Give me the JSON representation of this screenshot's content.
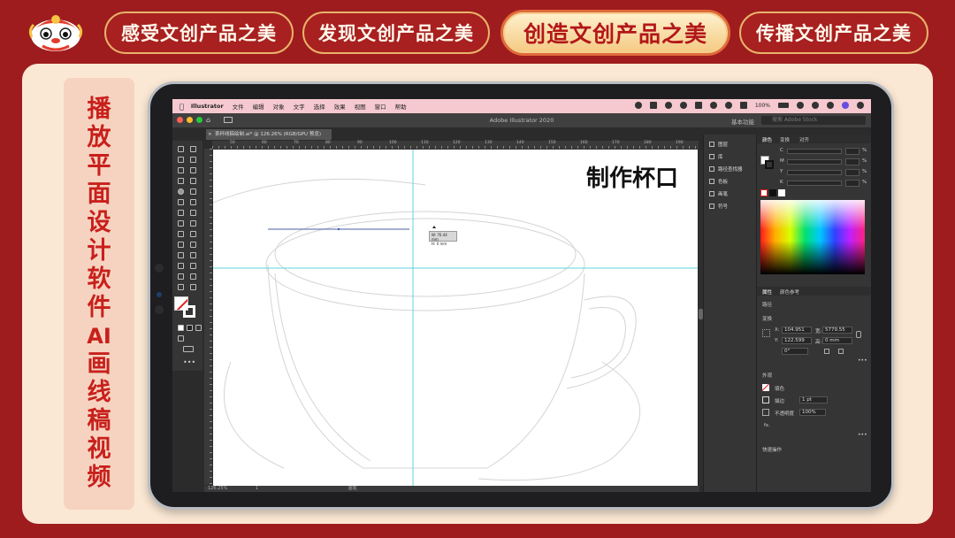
{
  "nav": {
    "tabs": [
      {
        "label": "感受文创产品之美",
        "active": false
      },
      {
        "label": "发现文创产品之美",
        "active": false
      },
      {
        "label": "创造文创产品之美",
        "active": true
      },
      {
        "label": "传播文创产品之美",
        "active": false
      }
    ]
  },
  "side_title": [
    "播",
    "放",
    "平",
    "面",
    "设",
    "计",
    "软",
    "件",
    "A",
    "I",
    "画",
    "线",
    "稿",
    "视",
    "频"
  ],
  "screen": {
    "menubar": {
      "app": "Illustrator",
      "items": [
        "文件",
        "编辑",
        "对象",
        "文字",
        "选择",
        "效果",
        "视图",
        "窗口",
        "帮助"
      ],
      "battery": "100%"
    },
    "titlebar": {
      "title": "Adobe Illustrator 2020",
      "workspace": "基本功能",
      "stock_placeholder": "搜索 Adobe Stock"
    },
    "doc_tab": "茶杯线稿绘制.ai* @ 126.26% (RGB/GPU 预览)",
    "ruler_ticks": [
      "50",
      "60",
      "70",
      "80",
      "90",
      "100",
      "110",
      "120",
      "130",
      "140",
      "150",
      "160",
      "170",
      "180",
      "190"
    ],
    "canvas_label": "制作杯口",
    "readout": {
      "w": "W: 76.44 mm",
      "h": "H: 0 mm"
    },
    "status": {
      "zoom": "126.25%",
      "page": "1",
      "mode": "画笔"
    },
    "mid_panel": [
      "图层",
      "库",
      "路径查找器",
      "色板",
      "画笔",
      "符号"
    ],
    "right_panel": {
      "tabs": [
        "颜色",
        "变换",
        "对齐"
      ],
      "channels": [
        "C",
        "M",
        "Y",
        "K"
      ],
      "percent": "%",
      "prop_tabs": [
        "属性",
        "颜色参考"
      ],
      "section_transform": "变换",
      "x_label": "X:",
      "x_value": "104.951",
      "y_label": "Y:",
      "y_value": "122.599",
      "w_label": "宽:",
      "w_value": "5779.55",
      "h_label": "高:",
      "h_value": "0 mm",
      "rotation": "0°",
      "section_appearance": "外观",
      "fill_label": "填色",
      "stroke_label": "描边",
      "stroke_value": "1 pt",
      "opacity_label": "不透明度",
      "opacity_value": "100%",
      "fx": "fx.",
      "quick_actions": "快速操作",
      "section_top": "路径"
    }
  },
  "colors": {
    "background": "#9e1c1e",
    "panel": "#fbe8d4",
    "accent_red": "#c8201c",
    "active_tab_bg": "#f4c981"
  }
}
